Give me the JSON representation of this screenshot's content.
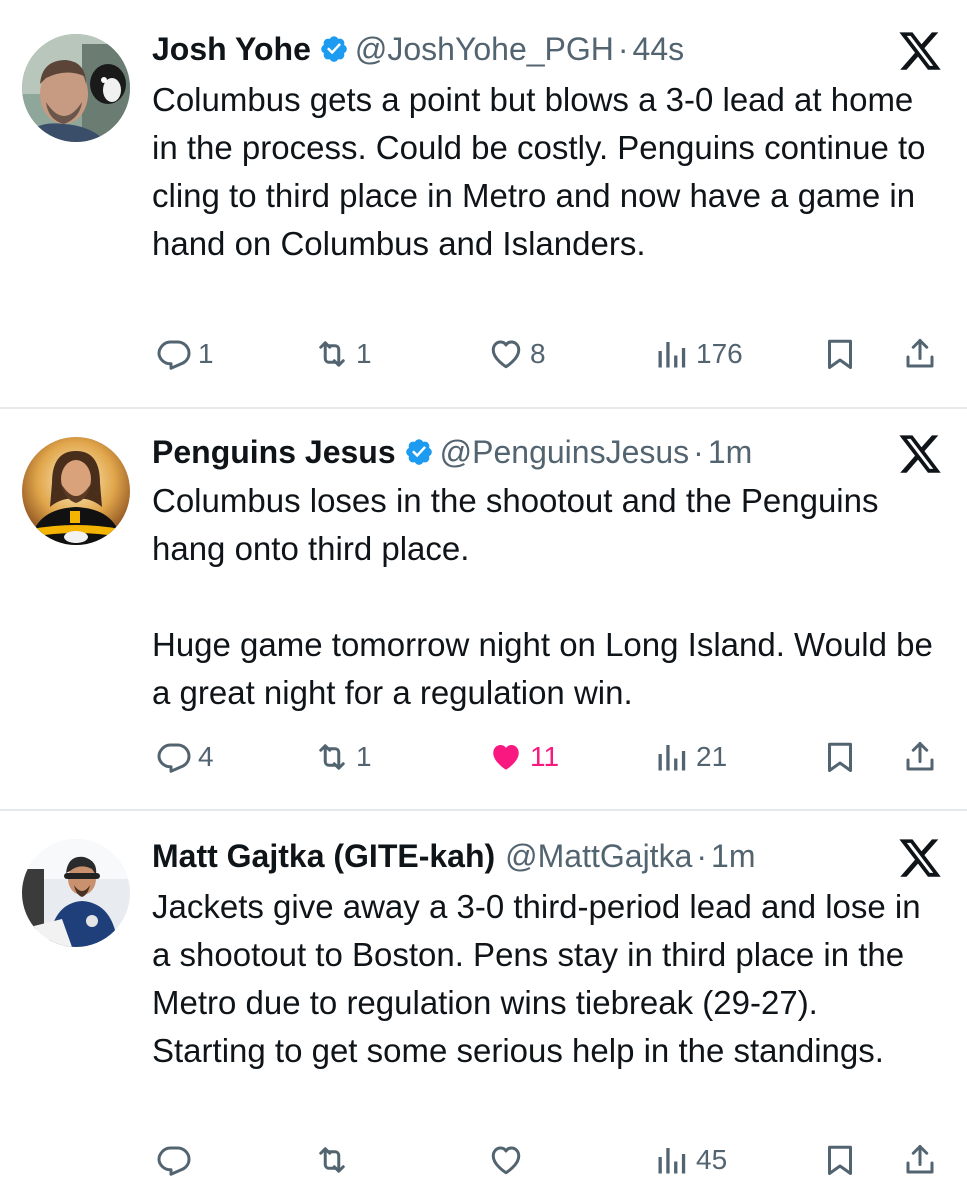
{
  "tweets": [
    {
      "name": "Josh Yohe",
      "handle": "@JoshYohe_PGH",
      "dot": "·",
      "time": "44s",
      "text": "Columbus gets a point but blows a 3-0 lead at home in the process. Could be costly. Penguins continue to cling to third place in Metro and now have a game in hand on Columbus and Islanders.",
      "replies": "1",
      "retweets": "1",
      "likes": "8",
      "views": "176",
      "liked": false
    },
    {
      "name": "Penguins Jesus",
      "handle": "@PenguinsJesus",
      "dot": "·",
      "time": "1m",
      "text": "Columbus loses in the shootout and the Penguins hang onto third place.\n\nHuge game tomorrow night on Long Island. Would be a great night for a regulation win.",
      "replies": "4",
      "retweets": "1",
      "likes": "11",
      "views": "21",
      "liked": true
    },
    {
      "name": "Matt Gajtka (GITE-kah)",
      "handle": "@MattGajtka",
      "dot": "·",
      "time": "1m",
      "text": "Jackets give away a 3-0 third-period lead and lose in a shootout to Boston. Pens stay in third place in the Metro due to regulation wins tiebreak (29-27). Starting to get some serious help in the standings.",
      "replies": "",
      "retweets": "",
      "likes": "",
      "views": "45",
      "liked": false
    }
  ],
  "icons": {
    "verified": "verified-badge-icon",
    "platform": "x-logo-icon",
    "reply": "reply-icon",
    "retweet": "retweet-icon",
    "like": "heart-icon",
    "views": "views-icon",
    "bookmark": "bookmark-icon",
    "share": "share-icon"
  },
  "colors": {
    "text": "#0f1419",
    "secondary": "#536471",
    "verified": "#1d9bf0",
    "like_active": "#f91880",
    "divider": "#e6e9eb"
  }
}
